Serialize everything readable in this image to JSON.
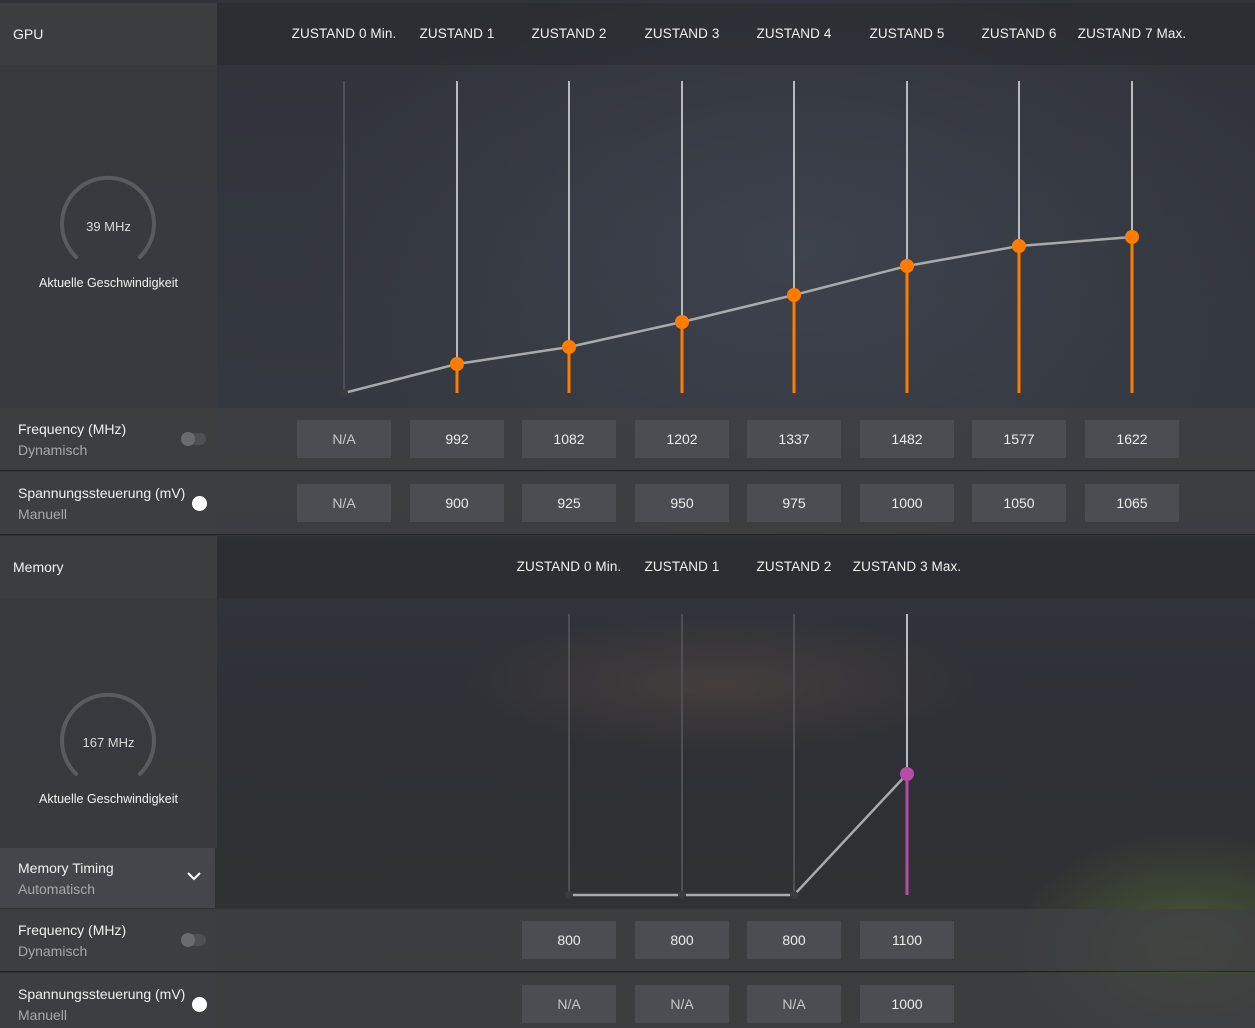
{
  "gpu": {
    "title": "GPU",
    "states": [
      "ZUSTAND 0 Min.",
      "ZUSTAND 1",
      "ZUSTAND 2",
      "ZUSTAND 3",
      "ZUSTAND 4",
      "ZUSTAND 5",
      "ZUSTAND 6",
      "ZUSTAND 7 Max."
    ],
    "gauge": {
      "value": "39 MHz",
      "caption": "Aktuelle Geschwindigkeit"
    },
    "frequency": {
      "label": "Frequency (MHz)",
      "mode": "Dynamisch",
      "toggle_on": false,
      "values": [
        "N/A",
        "992",
        "1082",
        "1202",
        "1337",
        "1482",
        "1577",
        "1622"
      ]
    },
    "voltage": {
      "label": "Spannungssteuerung (mV)",
      "mode": "Manuell",
      "toggle_on": true,
      "values": [
        "N/A",
        "900",
        "925",
        "950",
        "975",
        "1000",
        "1050",
        "1065"
      ]
    },
    "accent_color": "#ff7c00"
  },
  "memory": {
    "title": "Memory",
    "states": [
      "ZUSTAND 0 Min.",
      "ZUSTAND 1",
      "ZUSTAND 2",
      "ZUSTAND 3 Max."
    ],
    "gauge": {
      "value": "167 MHz",
      "caption": "Aktuelle Geschwindigkeit"
    },
    "timing": {
      "label": "Memory Timing",
      "value": "Automatisch",
      "icon": "chevron-down-icon"
    },
    "frequency": {
      "label": "Frequency (MHz)",
      "mode": "Dynamisch",
      "toggle_on": false,
      "values": [
        "800",
        "800",
        "800",
        "1100"
      ]
    },
    "voltage": {
      "label": "Spannungssteuerung (mV)",
      "mode": "Manuell",
      "toggle_on": true,
      "values": [
        "N/A",
        "N/A",
        "N/A",
        "1000"
      ]
    },
    "accent_color": "#b84aa8"
  }
}
